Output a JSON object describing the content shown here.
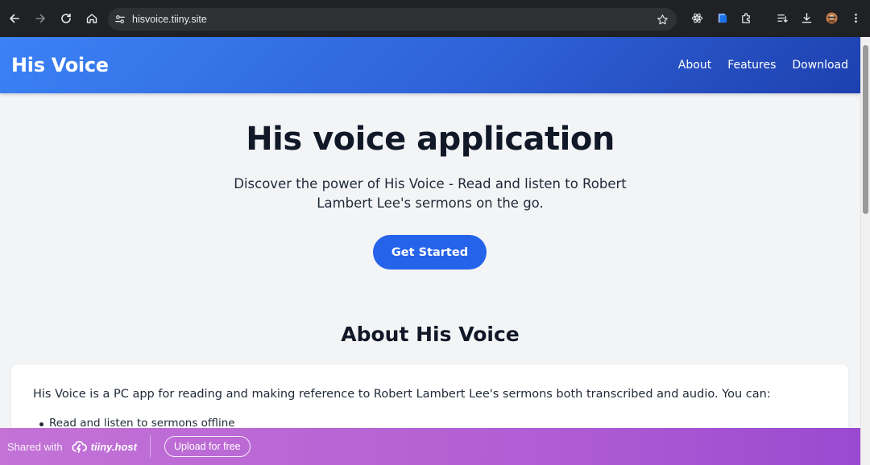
{
  "browser": {
    "url": "hisvoice.tiiny.site",
    "icons": [
      "back-icon",
      "forward-icon",
      "reload-icon",
      "home-icon",
      "site-settings-icon",
      "bookmark-star-icon",
      "extension-react-icon",
      "extension-docs-icon",
      "extensions-puzzle-icon",
      "reading-list-icon",
      "download-icon",
      "profile-avatar-icon",
      "menu-kebab-icon"
    ]
  },
  "site": {
    "brand": "His Voice",
    "nav": [
      {
        "label": "About"
      },
      {
        "label": "Features"
      },
      {
        "label": "Download"
      }
    ],
    "hero": {
      "title": "His voice application",
      "subtitle": "Discover the power of His Voice - Read and listen to Robert Lambert Lee's sermons on the go.",
      "cta": "Get Started"
    },
    "about": {
      "title": "About His Voice",
      "text": "His Voice is a PC app for reading and making reference to Robert Lambert Lee's sermons both transcribed and audio. You can:",
      "items": [
        "Read and listen to sermons offline"
      ]
    },
    "colors": {
      "header_start": "#3b82f6",
      "header_end": "#1e40af",
      "cta": "#2563eb"
    }
  },
  "tiny": {
    "shared_with": "Shared with",
    "brand": "tiiny.host",
    "upload": "Upload for free"
  }
}
